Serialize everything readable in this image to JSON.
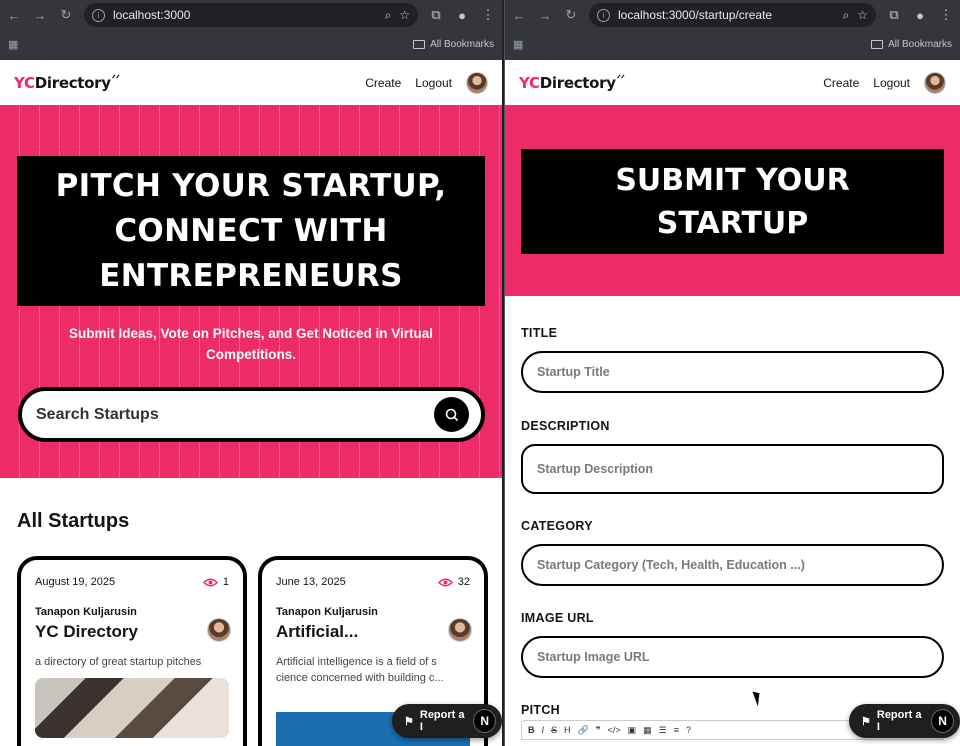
{
  "left": {
    "browser": {
      "url": "localhost:3000",
      "bookmarks_label": "All Bookmarks"
    },
    "nav": {
      "logo_yc": "YC",
      "logo_rest": "Directory",
      "create": "Create",
      "logout": "Logout"
    },
    "hero": {
      "title": "PITCH YOUR STARTUP, CONNECT WITH ENTREPRENEURS",
      "subtitle": "Submit Ideas, Vote on Pitches, and Get Noticed in Virtual Competitions.",
      "search_placeholder": "Search Startups"
    },
    "section_title": "All Startups",
    "cards": [
      {
        "date": "August 19, 2025",
        "views": "1",
        "author": "Tanapon Kuljarusin",
        "title": "YC Directory",
        "description": "a directory of great startup pitches"
      },
      {
        "date": "June 13, 2025",
        "views": "32",
        "author": "Tanapon Kuljarusin",
        "title": "Artificial...",
        "description": "Artificial intelligence is a field of s cience concerned with building c..."
      }
    ],
    "report_label": "Report a I",
    "report_badge": "N"
  },
  "right": {
    "browser": {
      "url": "localhost:3000/startup/create",
      "bookmarks_label": "All Bookmarks"
    },
    "nav": {
      "logo_yc": "YC",
      "logo_rest": "Directory",
      "create": "Create",
      "logout": "Logout"
    },
    "hero_title": "SUBMIT YOUR STARTUP",
    "form": {
      "title_label": "TITLE",
      "title_placeholder": "Startup Title",
      "description_label": "DESCRIPTION",
      "description_placeholder": "Startup Description",
      "category_label": "CATEGORY",
      "category_placeholder": "Startup Category (Tech, Health, Education ...)",
      "image_label": "IMAGE URL",
      "image_placeholder": "Startup Image URL",
      "pitch_label": "PITCH"
    },
    "report_label": "Report a I",
    "report_badge": "N"
  },
  "colors": {
    "brand_pink": "#ee2b69",
    "black": "#000000",
    "chrome": "#35363a"
  },
  "icons": [
    "back-icon",
    "forward-icon",
    "reload-icon",
    "info-icon",
    "zoom-icon",
    "star-icon",
    "extensions-icon",
    "profile-icon",
    "menu-icon",
    "apps-grid-icon",
    "folder-icon",
    "search-icon",
    "eye-icon",
    "report-icon"
  ]
}
